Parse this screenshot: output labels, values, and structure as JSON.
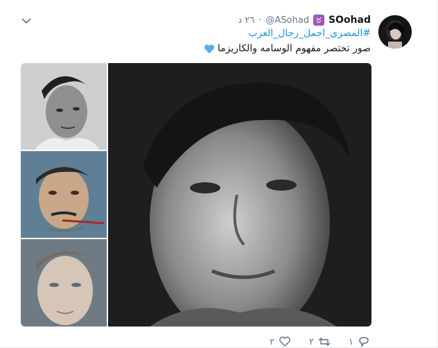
{
  "tweet": {
    "display_name": "SOohad",
    "badge_glyph": "♉",
    "handle": "@ASohad",
    "separator": "·",
    "time": "٢٦ د",
    "hashtag": "#المصرى_احمل_رجال_العرب",
    "text": "صور تختصر مفهوم الوسامه والكاريزما"
  },
  "actions": {
    "reply_count": "١",
    "retweet_count": "٢",
    "like_count": "٢"
  },
  "colors": {
    "link": "#1b95e0",
    "muted": "#657786",
    "text": "#14171a",
    "heart": "#5dade2"
  },
  "icons": [
    "caret-down-icon",
    "taurus-badge-icon",
    "blue-heart-icon",
    "reply-icon",
    "retweet-icon",
    "like-icon"
  ]
}
